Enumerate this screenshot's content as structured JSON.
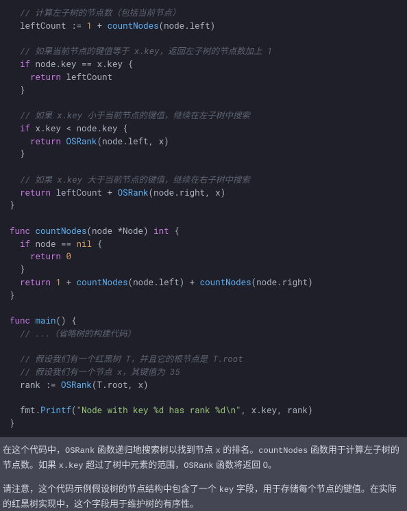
{
  "code": {
    "lines": [
      {
        "indent": 1,
        "segments": [
          {
            "cls": "c-comment",
            "t": "// 计算左子树的节点数（包括当前节点）"
          }
        ]
      },
      {
        "indent": 1,
        "segments": [
          {
            "cls": "c-plain",
            "t": "leftCount := "
          },
          {
            "cls": "c-literal",
            "t": "1"
          },
          {
            "cls": "c-plain",
            "t": " + "
          },
          {
            "cls": "c-funcname",
            "t": "countNodes"
          },
          {
            "cls": "c-plain",
            "t": "(node.left)"
          }
        ]
      },
      {
        "indent": 0,
        "segments": [
          {
            "cls": "c-plain",
            "t": ""
          }
        ]
      },
      {
        "indent": 1,
        "segments": [
          {
            "cls": "c-comment",
            "t": "// 如果当前节点的键值等于 x.key，返回左子树的节点数加上 1"
          }
        ]
      },
      {
        "indent": 1,
        "segments": [
          {
            "cls": "c-keyword",
            "t": "if"
          },
          {
            "cls": "c-plain",
            "t": " node.key == x.key {"
          }
        ]
      },
      {
        "indent": 2,
        "segments": [
          {
            "cls": "c-keyword",
            "t": "return"
          },
          {
            "cls": "c-plain",
            "t": " leftCount"
          }
        ]
      },
      {
        "indent": 1,
        "segments": [
          {
            "cls": "c-plain",
            "t": "}"
          }
        ]
      },
      {
        "indent": 0,
        "segments": [
          {
            "cls": "c-plain",
            "t": ""
          }
        ]
      },
      {
        "indent": 1,
        "segments": [
          {
            "cls": "c-comment",
            "t": "// 如果 x.key 小于当前节点的键值，继续在左子树中搜索"
          }
        ]
      },
      {
        "indent": 1,
        "segments": [
          {
            "cls": "c-keyword",
            "t": "if"
          },
          {
            "cls": "c-plain",
            "t": " x.key < node.key {"
          }
        ]
      },
      {
        "indent": 2,
        "segments": [
          {
            "cls": "c-keyword",
            "t": "return"
          },
          {
            "cls": "c-plain",
            "t": " "
          },
          {
            "cls": "c-funcname",
            "t": "OSRank"
          },
          {
            "cls": "c-plain",
            "t": "(node.left, x)"
          }
        ]
      },
      {
        "indent": 1,
        "segments": [
          {
            "cls": "c-plain",
            "t": "}"
          }
        ]
      },
      {
        "indent": 0,
        "segments": [
          {
            "cls": "c-plain",
            "t": ""
          }
        ]
      },
      {
        "indent": 1,
        "segments": [
          {
            "cls": "c-comment",
            "t": "// 如果 x.key 大于当前节点的键值，继续在右子树中搜索"
          }
        ]
      },
      {
        "indent": 1,
        "segments": [
          {
            "cls": "c-keyword",
            "t": "return"
          },
          {
            "cls": "c-plain",
            "t": " leftCount + "
          },
          {
            "cls": "c-funcname",
            "t": "OSRank"
          },
          {
            "cls": "c-plain",
            "t": "(node.right, x)"
          }
        ]
      },
      {
        "indent": 0,
        "segments": [
          {
            "cls": "c-plain",
            "t": "}"
          }
        ]
      },
      {
        "indent": 0,
        "segments": [
          {
            "cls": "c-plain",
            "t": ""
          }
        ]
      },
      {
        "indent": 0,
        "segments": [
          {
            "cls": "c-keyword",
            "t": "func"
          },
          {
            "cls": "c-plain",
            "t": " "
          },
          {
            "cls": "c-title",
            "t": "countNodes"
          },
          {
            "cls": "c-plain",
            "t": "(node *Node) "
          },
          {
            "cls": "c-keyword",
            "t": "int"
          },
          {
            "cls": "c-plain",
            "t": " {"
          }
        ]
      },
      {
        "indent": 1,
        "segments": [
          {
            "cls": "c-keyword",
            "t": "if"
          },
          {
            "cls": "c-plain",
            "t": " node == "
          },
          {
            "cls": "c-literal",
            "t": "nil"
          },
          {
            "cls": "c-plain",
            "t": " {"
          }
        ]
      },
      {
        "indent": 2,
        "segments": [
          {
            "cls": "c-keyword",
            "t": "return"
          },
          {
            "cls": "c-plain",
            "t": " "
          },
          {
            "cls": "c-literal",
            "t": "0"
          }
        ]
      },
      {
        "indent": 1,
        "segments": [
          {
            "cls": "c-plain",
            "t": "}"
          }
        ]
      },
      {
        "indent": 1,
        "segments": [
          {
            "cls": "c-keyword",
            "t": "return"
          },
          {
            "cls": "c-plain",
            "t": " "
          },
          {
            "cls": "c-literal",
            "t": "1"
          },
          {
            "cls": "c-plain",
            "t": " + "
          },
          {
            "cls": "c-funcname",
            "t": "countNodes"
          },
          {
            "cls": "c-plain",
            "t": "(node.left) + "
          },
          {
            "cls": "c-funcname",
            "t": "countNodes"
          },
          {
            "cls": "c-plain",
            "t": "(node.right)"
          }
        ]
      },
      {
        "indent": 0,
        "segments": [
          {
            "cls": "c-plain",
            "t": "}"
          }
        ]
      },
      {
        "indent": 0,
        "segments": [
          {
            "cls": "c-plain",
            "t": ""
          }
        ]
      },
      {
        "indent": 0,
        "segments": [
          {
            "cls": "c-keyword",
            "t": "func"
          },
          {
            "cls": "c-plain",
            "t": " "
          },
          {
            "cls": "c-title",
            "t": "main"
          },
          {
            "cls": "c-plain",
            "t": "() {"
          }
        ]
      },
      {
        "indent": 1,
        "segments": [
          {
            "cls": "c-comment",
            "t": "// ...（省略树的构建代码）"
          }
        ]
      },
      {
        "indent": 0,
        "segments": [
          {
            "cls": "c-plain",
            "t": ""
          }
        ]
      },
      {
        "indent": 1,
        "segments": [
          {
            "cls": "c-comment",
            "t": "// 假设我们有一个红黑树 T，并且它的根节点是 T.root"
          }
        ]
      },
      {
        "indent": 1,
        "segments": [
          {
            "cls": "c-comment",
            "t": "// 假设我们有一个节点 x，其键值为 35"
          }
        ]
      },
      {
        "indent": 1,
        "segments": [
          {
            "cls": "c-plain",
            "t": "rank := "
          },
          {
            "cls": "c-funcname",
            "t": "OSRank"
          },
          {
            "cls": "c-plain",
            "t": "(T.root, x)"
          }
        ]
      },
      {
        "indent": 0,
        "segments": [
          {
            "cls": "c-plain",
            "t": ""
          }
        ]
      },
      {
        "indent": 1,
        "segments": [
          {
            "cls": "c-plain",
            "t": "fmt."
          },
          {
            "cls": "c-funcname",
            "t": "Printf"
          },
          {
            "cls": "c-plain",
            "t": "("
          },
          {
            "cls": "c-string",
            "t": "\"Node with key %d has rank %d\\n\""
          },
          {
            "cls": "c-plain",
            "t": ", x.key, rank)"
          }
        ]
      },
      {
        "indent": 0,
        "segments": [
          {
            "cls": "c-plain",
            "t": "}"
          }
        ]
      }
    ]
  },
  "explain": {
    "p1_a": "在这个代码中，",
    "p1_code1": "OSRank",
    "p1_b": " 函数递归地搜索树以找到节点 ",
    "p1_code2": "x",
    "p1_c": " 的排名。",
    "p1_code3": "countNodes",
    "p1_d": " 函数用于计算左子树的节点数。如果 ",
    "p1_code4": "x.key",
    "p1_e": " 超过了树中元素的范围，",
    "p1_code5": "OSRank",
    "p1_f": " 函数将返回 0。",
    "p2_a": "请注意，这个代码示例假设树的节点结构中包含了一个 ",
    "p2_code1": "key",
    "p2_b": " 字段，用于存储每个节点的键值。在实际的红黑树实现中，这个字段用于维护树的有序性。"
  }
}
